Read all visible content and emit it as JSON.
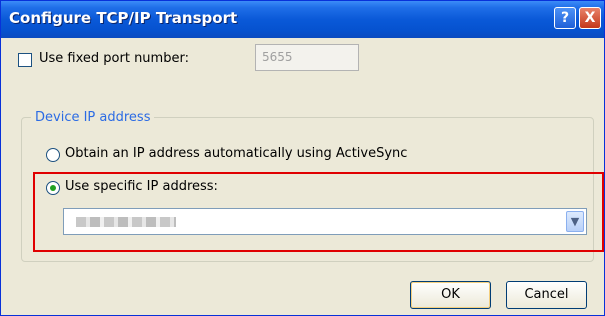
{
  "window": {
    "title": "Configure TCP/IP Transport",
    "help_label": "?",
    "close_label": "X"
  },
  "port": {
    "checkbox_label": "Use fixed port number:",
    "checked": false,
    "value": "5655",
    "enabled": false
  },
  "device_ip": {
    "group_title": "Device IP address",
    "option_auto_label": "Obtain an IP address automatically using ActiveSync",
    "option_specific_label": "Use specific IP address:",
    "selected_option": "specific",
    "ip_value_obscured": true
  },
  "buttons": {
    "ok_label": "OK",
    "cancel_label": "Cancel"
  },
  "colors": {
    "titlebar": "#0a59d8",
    "group_title": "#2b6be4",
    "highlight_border": "#e00000",
    "radio_selected": "#21a121"
  }
}
